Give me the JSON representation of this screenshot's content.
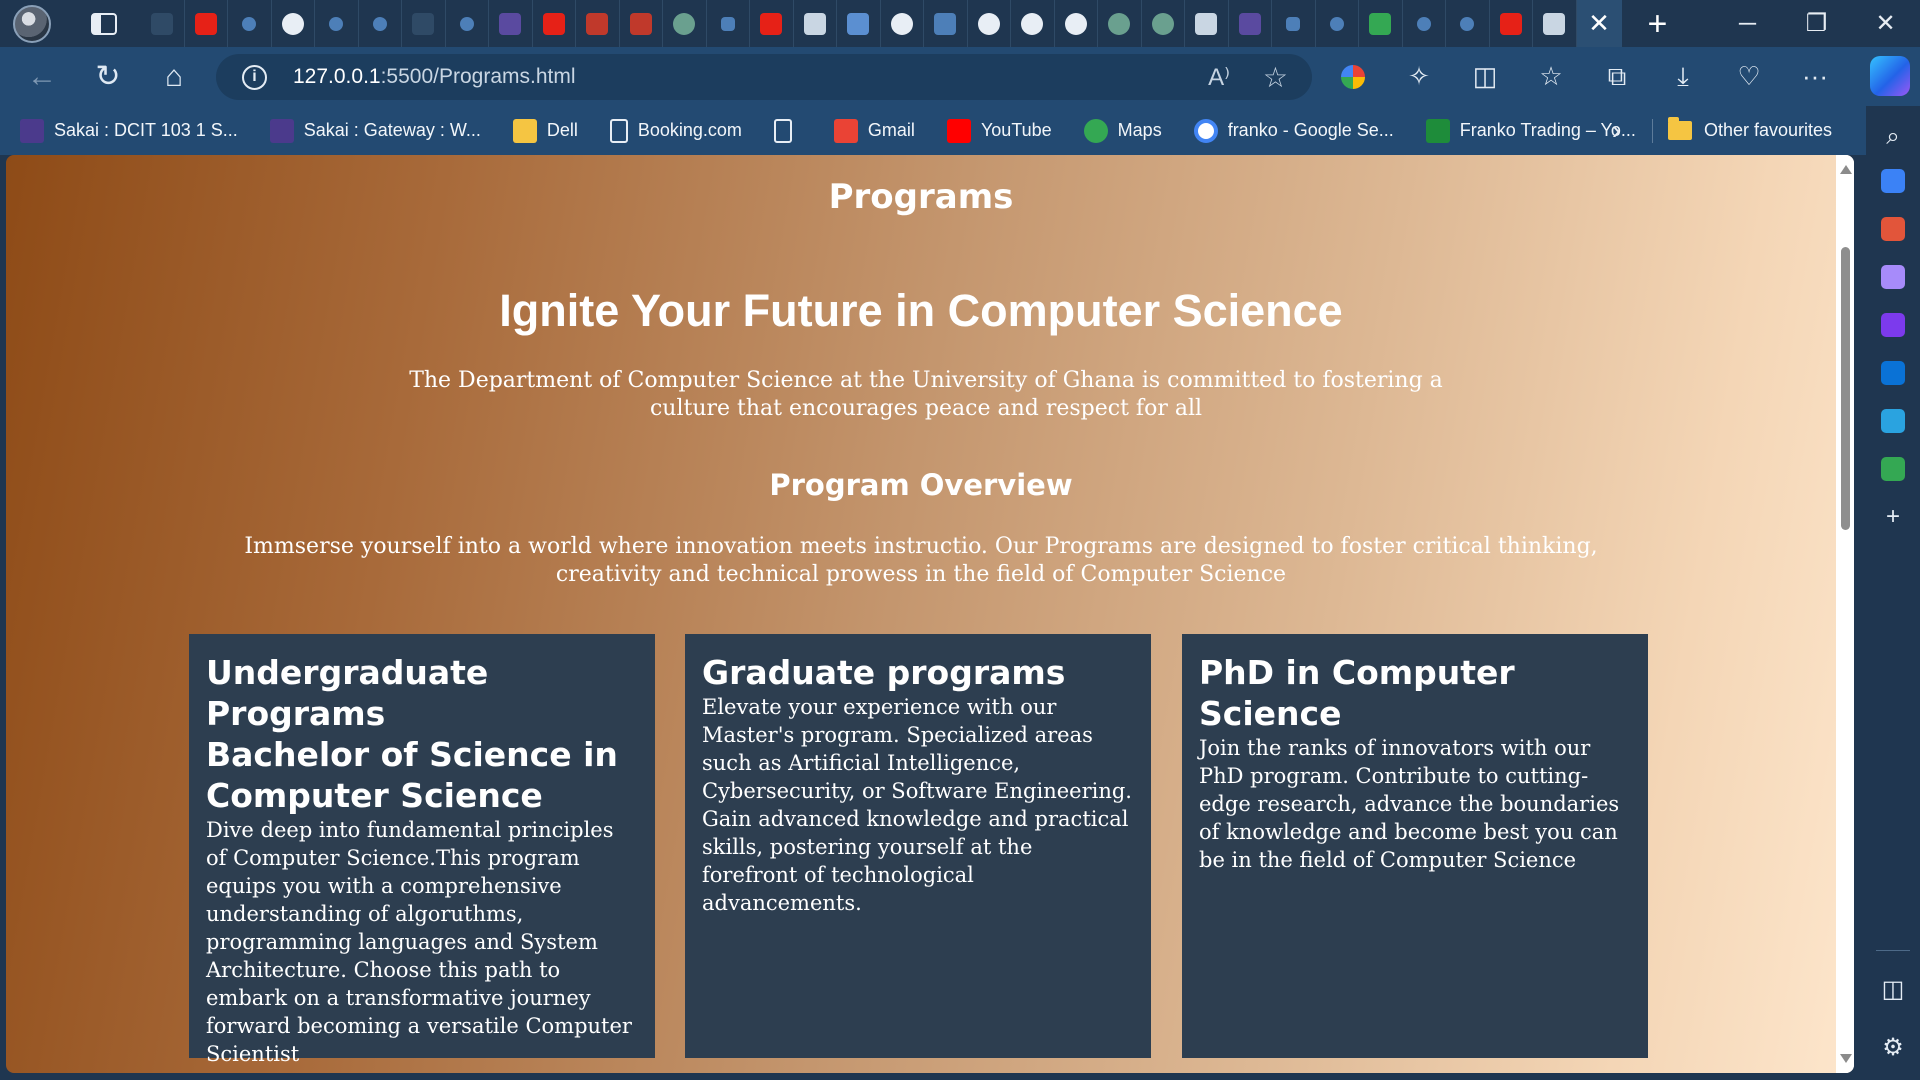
{
  "browser": {
    "tabs": {
      "icons": [
        "blank-tab-icon",
        "youtube-icon",
        "search-icon",
        "github-icon",
        "search-icon",
        "search-icon",
        "blank-tab-icon",
        "search-icon",
        "sakai-icon",
        "youtube-icon",
        "pdf-icon",
        "pdf-icon",
        "chatgpt-icon",
        "more-tabs-icon",
        "youtube-icon",
        "document-icon",
        "flag-icon",
        "github-icon",
        "docs-icon",
        "github-icon",
        "github-icon",
        "github-icon",
        "chatgpt-icon",
        "chatgpt-icon",
        "document-icon",
        "sakai-icon",
        "more-tabs-icon",
        "search-icon",
        "maps-icon",
        "search-icon",
        "search-icon",
        "youtube-icon",
        "document-icon"
      ],
      "active_close": "✕",
      "new_tab": "+"
    },
    "window_controls": {
      "minimize": "─",
      "restore": "❐",
      "close": "✕"
    },
    "nav": {
      "back": "←",
      "refresh": "↻",
      "home": "⌂"
    },
    "address": {
      "info": "i",
      "host": "127.0.0.1",
      "rest": ":5500/Programs.html",
      "read_aloud": "A⁾",
      "favorite": "☆"
    },
    "toolbar": {
      "extensions": "✧",
      "split": "◫",
      "favorites": "☆",
      "collections": "⧉",
      "downloads": "⤓",
      "health": "♡",
      "more": "···"
    },
    "favorites": [
      {
        "label": "Sakai : DCIT 103 1 S...",
        "icon": "sakai-icon",
        "color": "#4b3a8c"
      },
      {
        "label": "Sakai : Gateway : W...",
        "icon": "sakai-icon",
        "color": "#4b3a8c"
      },
      {
        "label": "Dell",
        "icon": "folder-icon",
        "color": "#f5c542"
      },
      {
        "label": "Booking.com",
        "icon": "document-icon",
        "color": "#e8eef5"
      },
      {
        "label": "",
        "icon": "document-icon",
        "color": "#e8eef5"
      },
      {
        "label": "Gmail",
        "icon": "gmail-icon",
        "color": "#ea4335"
      },
      {
        "label": "YouTube",
        "icon": "youtube-icon",
        "color": "#ff0000"
      },
      {
        "label": "Maps",
        "icon": "maps-icon",
        "color": "#34a853"
      },
      {
        "label": "franko - Google Se...",
        "icon": "google-icon",
        "color": "#ffffff"
      },
      {
        "label": "Franko Trading – Yo...",
        "icon": "franko-icon",
        "color": "#1e8c3a"
      }
    ],
    "favorites_more": "›",
    "other_favorites": "Other favourites"
  },
  "page": {
    "title": "Programs",
    "hero": "Ignite Your Future in Computer Science",
    "lede": "The Department of Computer Science at the University of Ghana is committed to fostering a culture that encourages peace and respect for all",
    "overview_heading": "Program Overview",
    "overview_text": "Immserse yourself into a world where innovation meets instructio. Our Programs are designed to foster critical thinking, creativity and technical prowess in the field of Computer Science",
    "cards": [
      {
        "title": "Undergraduate Programs",
        "subtitle": "Bachelor of Science in Computer Science",
        "body": "Dive deep into fundamental principles of Computer Science.This program equips you with a comprehensive understanding of algoruthms, programming languages and System Architecture. Choose this path to embark on a transformative journey forward becoming a versatile Computer Scientist"
      },
      {
        "title": "Graduate programs",
        "subtitle": "",
        "body": "Elevate your experience with our Master's program. Specialized areas such as Artificial Intelligence, Cybersecurity, or Software Engineering. Gain advanced knowledge and practical skills, postering yourself at the forefront of technological advancements."
      },
      {
        "title": "PhD in Computer Science",
        "subtitle": "",
        "body": "Join the ranks of innovators with our PhD program. Contribute to cutting-edge research, advance the boundaries of knowledge and become best you can be in the field of Computer Science"
      }
    ]
  },
  "sidebar": {
    "items": [
      {
        "name": "search-icon",
        "glyph": "⌕",
        "color": "#e4ecf4"
      },
      {
        "name": "shopping-tag-icon",
        "glyph": "",
        "color": "#3b82f6"
      },
      {
        "name": "toolbox-icon",
        "glyph": "",
        "color": "#e2553a"
      },
      {
        "name": "games-icon",
        "glyph": "",
        "color": "#a78bfa"
      },
      {
        "name": "copilot-app-icon",
        "glyph": "",
        "color": "#7c3aed"
      },
      {
        "name": "outlook-icon",
        "glyph": "",
        "color": "#0a72d6"
      },
      {
        "name": "telegram-icon",
        "glyph": "",
        "color": "#2aa3e0"
      },
      {
        "name": "tree-icon",
        "glyph": "",
        "color": "#34a853"
      },
      {
        "name": "add-icon",
        "glyph": "+",
        "color": "#e4ecf4"
      }
    ],
    "bottom": {
      "panel": "◫",
      "settings": "⚙"
    }
  }
}
